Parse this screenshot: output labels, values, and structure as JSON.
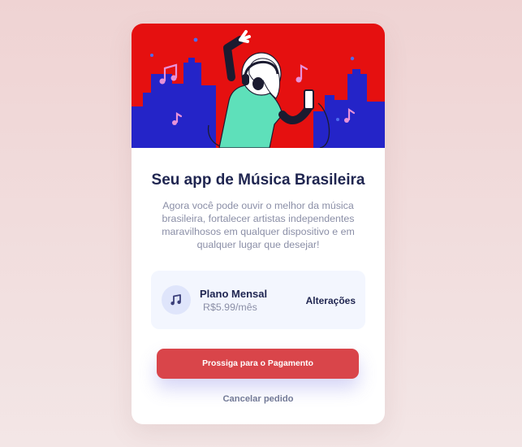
{
  "card": {
    "title": "Seu app de Música Brasileira",
    "description": "Agora você pode ouvir o melhor da música brasileira, fortalecer artistas independentes maravilhosos em qualquer dispositivo e em qualquer lugar que desejar!"
  },
  "plan": {
    "icon": "music-note-icon",
    "name": "Plano Mensal",
    "price": "R$5.99/mês",
    "change_label": "Alterações"
  },
  "actions": {
    "pay_label": "Prossiga para o Pagamento",
    "cancel_label": "Cancelar pedido"
  },
  "colors": {
    "hero_background": "#e51010",
    "buildings": "#2424c8",
    "primary_button": "#d9454a",
    "title_text": "#1f2550",
    "muted_text": "#8b8fa7",
    "plan_background": "#f3f6fe"
  }
}
